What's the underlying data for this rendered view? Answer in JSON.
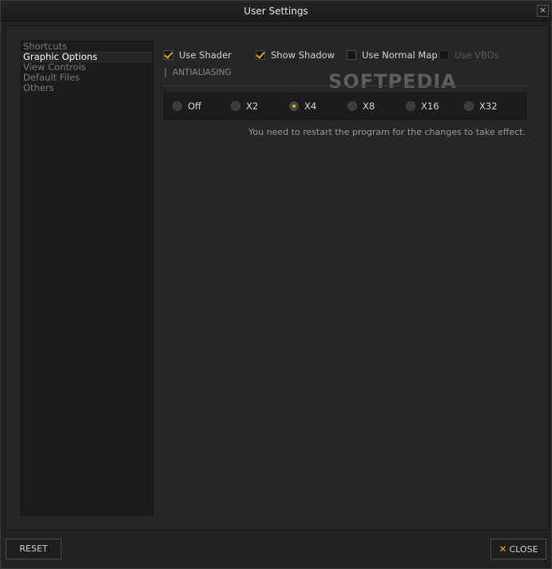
{
  "window": {
    "title": "User Settings",
    "close_glyph": "×"
  },
  "sidebar": {
    "items": [
      {
        "label": "Shortcuts"
      },
      {
        "label": "Graphic Options"
      },
      {
        "label": "View Controls"
      },
      {
        "label": "Default Files"
      },
      {
        "label": "Others"
      }
    ],
    "active_index": 1
  },
  "options": {
    "checkboxes": [
      {
        "label": "Use Shader",
        "checked": true
      },
      {
        "label": "Show Shadow",
        "checked": true
      },
      {
        "label": "Use Normal Map",
        "checked": false
      },
      {
        "label": "Use VBOs",
        "checked": false
      }
    ],
    "section_label": "ANTIALIASING",
    "radios": [
      {
        "label": "Off",
        "selected": false
      },
      {
        "label": "X2",
        "selected": false
      },
      {
        "label": "X4",
        "selected": true
      },
      {
        "label": "X8",
        "selected": false
      },
      {
        "label": "X16",
        "selected": false
      },
      {
        "label": "X32",
        "selected": false
      }
    ],
    "notice": "You need to restart the program for the changes to take effect."
  },
  "watermark": {
    "text": "SOFTPEDIA"
  },
  "footer": {
    "reset_label": "RESET",
    "close_label": "CLOSE",
    "close_icon": "✕"
  },
  "colors": {
    "accent": "#e8a41c",
    "background": "#222222",
    "panel": "#1c1c1c"
  }
}
